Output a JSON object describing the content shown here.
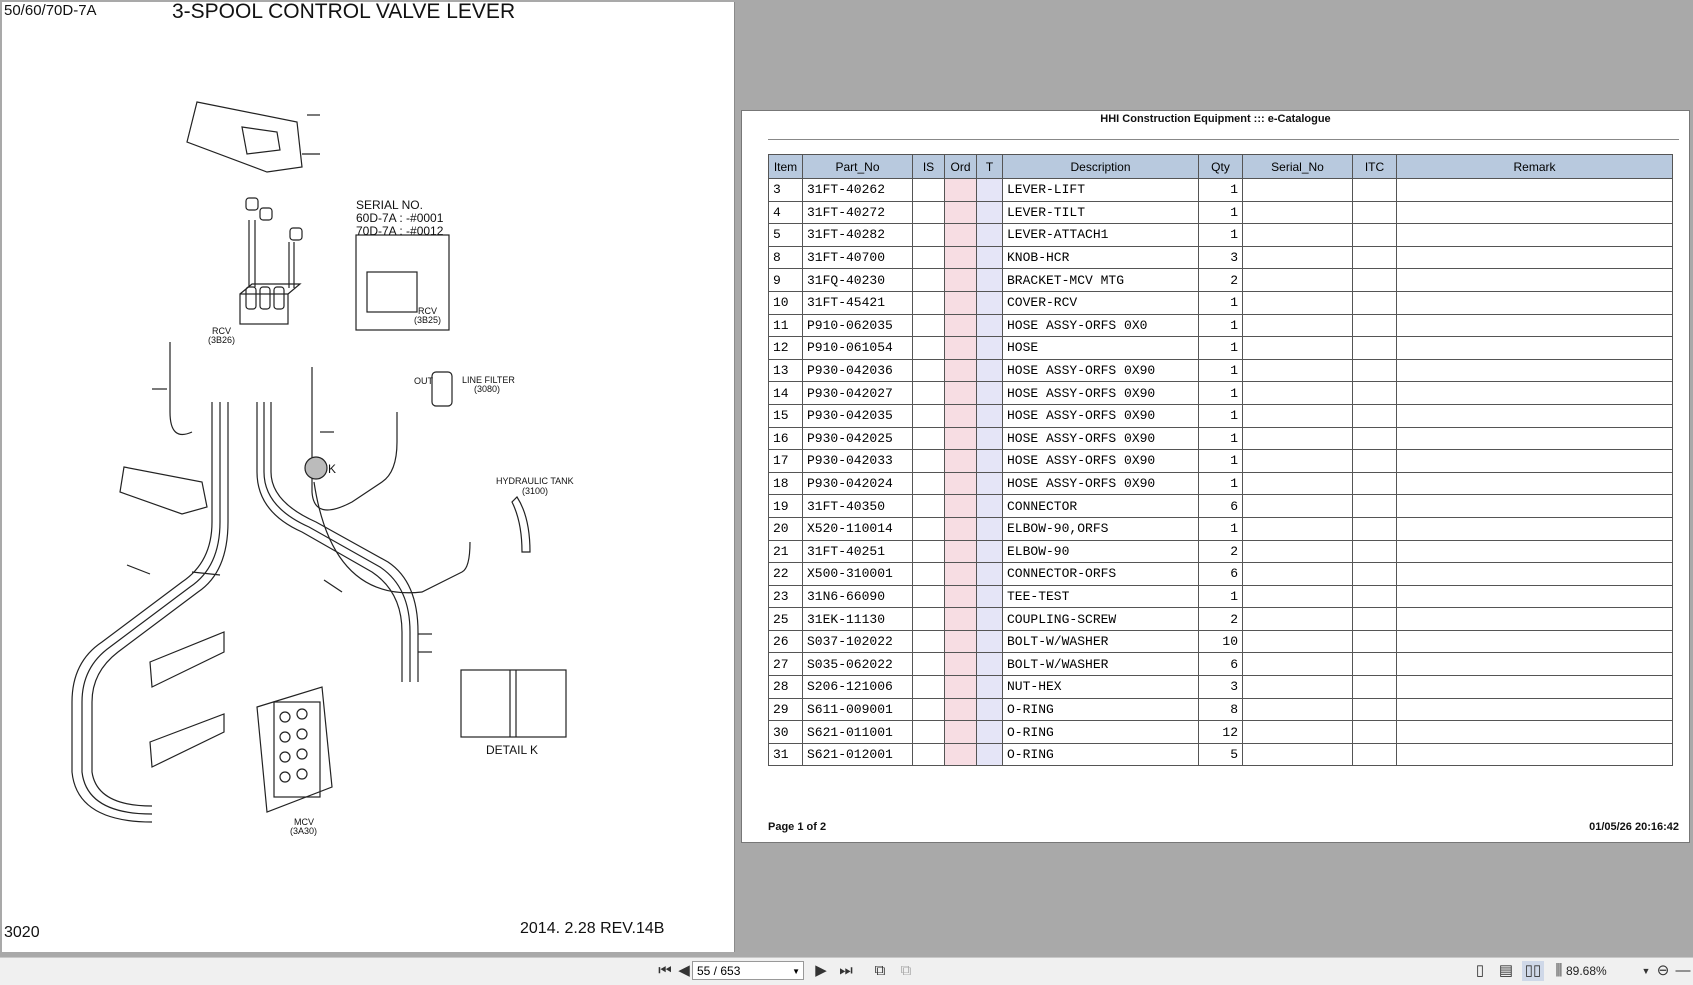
{
  "drawing": {
    "model": "50/60/70D-7A",
    "title": "3-SPOOL CONTROL VALVE LEVER",
    "page_code": "3020",
    "revision": "2014. 2.28  REV.14B",
    "serial_heading": "SERIAL NO.",
    "serial_60": "60D-7A : -#0001",
    "serial_70": "70D-7A : -#0012",
    "rcv_a": "RCV",
    "rcv_a_code": "(3B26)",
    "rcv_b": "RCV",
    "rcv_b_code": "(3B25)",
    "line_filter": "LINE FILTER",
    "line_filter_code": "(3080)",
    "hyd_tank": "HYDRAULIC TANK",
    "hyd_tank_code": "(3100)",
    "mcv": "MCV",
    "mcv_code": "(3A30)",
    "detail": "DETAIL K",
    "detail_marker": "K",
    "out_label": "OUT"
  },
  "catalogue": {
    "header": "HHI Construction Equipment ::: e-Catalogue",
    "columns": [
      "Item",
      "Part_No",
      "IS",
      "Ord",
      "T",
      "Description",
      "Qty",
      "Serial_No",
      "ITC",
      "Remark"
    ],
    "rows": [
      {
        "item": "3",
        "part": "31FT-40262",
        "desc": "LEVER-LIFT",
        "qty": "1"
      },
      {
        "item": "4",
        "part": "31FT-40272",
        "desc": "LEVER-TILT",
        "qty": "1"
      },
      {
        "item": "5",
        "part": "31FT-40282",
        "desc": "LEVER-ATTACH1",
        "qty": "1"
      },
      {
        "item": "8",
        "part": "31FT-40700",
        "desc": "KNOB-HCR",
        "qty": "3"
      },
      {
        "item": "9",
        "part": "31FQ-40230",
        "desc": "BRACKET-MCV MTG",
        "qty": "2"
      },
      {
        "item": "10",
        "part": "31FT-45421",
        "desc": "COVER-RCV",
        "qty": "1"
      },
      {
        "item": "11",
        "part": "P910-062035",
        "desc": "HOSE ASSY-ORFS 0X0",
        "qty": "1"
      },
      {
        "item": "12",
        "part": "P910-061054",
        "desc": "HOSE",
        "qty": "1"
      },
      {
        "item": "13",
        "part": "P930-042036",
        "desc": "HOSE ASSY-ORFS 0X90",
        "qty": "1"
      },
      {
        "item": "14",
        "part": "P930-042027",
        "desc": "HOSE ASSY-ORFS 0X90",
        "qty": "1"
      },
      {
        "item": "15",
        "part": "P930-042035",
        "desc": "HOSE ASSY-ORFS 0X90",
        "qty": "1"
      },
      {
        "item": "16",
        "part": "P930-042025",
        "desc": "HOSE ASSY-ORFS 0X90",
        "qty": "1"
      },
      {
        "item": "17",
        "part": "P930-042033",
        "desc": "HOSE ASSY-ORFS 0X90",
        "qty": "1"
      },
      {
        "item": "18",
        "part": "P930-042024",
        "desc": "HOSE ASSY-ORFS 0X90",
        "qty": "1"
      },
      {
        "item": "19",
        "part": "31FT-40350",
        "desc": "CONNECTOR",
        "qty": "6"
      },
      {
        "item": "20",
        "part": "X520-110014",
        "desc": "ELBOW-90,ORFS",
        "qty": "1"
      },
      {
        "item": "21",
        "part": "31FT-40251",
        "desc": "ELBOW-90",
        "qty": "2"
      },
      {
        "item": "22",
        "part": "X500-310001",
        "desc": "CONNECTOR-ORFS",
        "qty": "6"
      },
      {
        "item": "23",
        "part": "31N6-66090",
        "desc": "TEE-TEST",
        "qty": "1"
      },
      {
        "item": "25",
        "part": "31EK-11130",
        "desc": "COUPLING-SCREW",
        "qty": "2"
      },
      {
        "item": "26",
        "part": "S037-102022",
        "desc": "BOLT-W/WASHER",
        "qty": "10"
      },
      {
        "item": "27",
        "part": "S035-062022",
        "desc": "BOLT-W/WASHER",
        "qty": "6"
      },
      {
        "item": "28",
        "part": "S206-121006",
        "desc": "NUT-HEX",
        "qty": "3"
      },
      {
        "item": "29",
        "part": "S611-009001",
        "desc": "O-RING",
        "qty": "8"
      },
      {
        "item": "30",
        "part": "S621-011001",
        "desc": "O-RING",
        "qty": "12"
      },
      {
        "item": "31",
        "part": "S621-012001",
        "desc": "O-RING",
        "qty": "5"
      }
    ],
    "footer_page": "Page 1 of 2",
    "footer_date": "01/05/26 20:16:42"
  },
  "toolbar": {
    "page_value": "55 / 653",
    "zoom": "89.68%"
  },
  "colors": {
    "header_bg": "#b8c9de",
    "ord_col": "#f7dde3",
    "t_col": "#e5e5f7"
  }
}
